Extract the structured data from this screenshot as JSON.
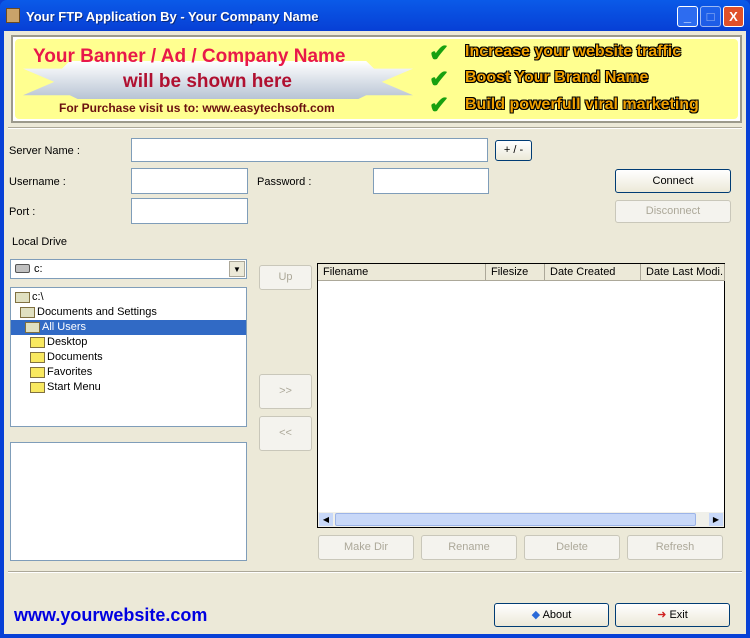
{
  "window": {
    "title": "Your FTP Application By - Your Company Name",
    "minimize": "_",
    "maximize": "□",
    "close": "X"
  },
  "banner": {
    "line1": "Your Banner / Ad / Company Name",
    "line2": "will be shown here",
    "line3": "For Purchase visit us to: www.easytechsoft.com",
    "bullets": [
      "Increase your website traffic",
      "Boost Your Brand Name",
      "Build powerfull viral marketing"
    ]
  },
  "form": {
    "server_label": "Server Name :",
    "server_value": "",
    "plusminus": "+ / -",
    "username_label": "Username :",
    "username_value": "",
    "password_label": "Password :",
    "password_value": "",
    "port_label": "Port :",
    "port_value": "",
    "connect": "Connect",
    "disconnect": "Disconnect"
  },
  "local": {
    "label": "Local Drive",
    "drive": "c:",
    "tree": [
      {
        "label": "c:\\",
        "open": true,
        "indent": 0
      },
      {
        "label": "Documents and Settings",
        "open": true,
        "indent": 1
      },
      {
        "label": "All Users",
        "open": true,
        "indent": 2,
        "selected": true
      },
      {
        "label": "Desktop",
        "indent": 3
      },
      {
        "label": "Documents",
        "indent": 3
      },
      {
        "label": "Favorites",
        "indent": 3
      },
      {
        "label": "Start Menu",
        "indent": 3
      }
    ]
  },
  "transfer": {
    "up": "Up",
    "upload": ">>",
    "download": "<<"
  },
  "remote": {
    "columns": [
      "Filename",
      "Filesize",
      "Date Created",
      "Date Last Modi..."
    ],
    "make_dir": "Make Dir",
    "rename": "Rename",
    "delete": "Delete",
    "refresh": "Refresh"
  },
  "footer": {
    "website": "www.yourwebsite.com",
    "about": "About",
    "exit": "Exit"
  }
}
